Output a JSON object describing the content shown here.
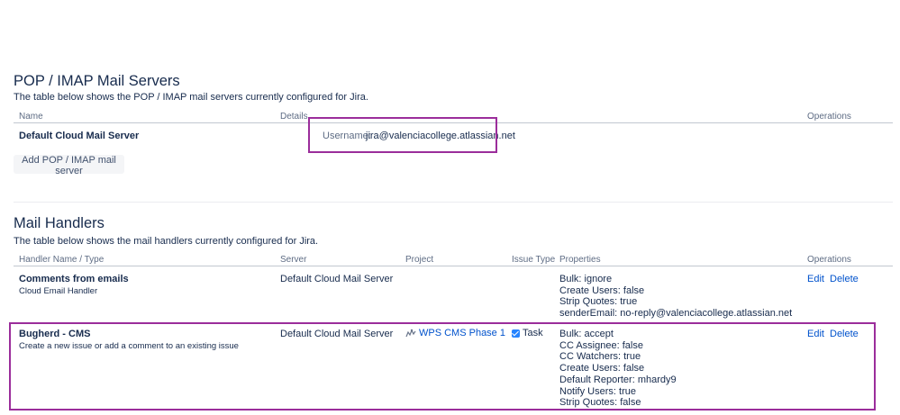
{
  "mail_servers": {
    "title": "POP / IMAP Mail Servers",
    "description": "The table below shows the POP / IMAP mail servers currently configured for Jira.",
    "columns": {
      "name": "Name",
      "details": "Details",
      "operations": "Operations"
    },
    "rows": [
      {
        "name": "Default Cloud Mail Server",
        "username_label": "Username:",
        "username": "jira@valenciacollege.atlassian.net"
      }
    ],
    "add_button": "Add POP / IMAP mail server"
  },
  "mail_handlers": {
    "title": "Mail Handlers",
    "description": "The table below shows the mail handlers currently configured for Jira.",
    "columns": {
      "name": "Handler Name / Type",
      "server": "Server",
      "project": "Project",
      "issue_type": "Issue Type",
      "properties": "Properties",
      "operations": "Operations"
    },
    "rows": [
      {
        "name": "Comments from emails",
        "type": "Cloud Email Handler",
        "server": "Default Cloud Mail Server",
        "project": "",
        "issue_type": "",
        "properties": [
          "Bulk: ignore",
          "Create Users: false",
          "Strip Quotes: true",
          "senderEmail: no-reply@valenciacollege.atlassian.net"
        ],
        "edit": "Edit",
        "delete": "Delete"
      },
      {
        "name": "Bugherd - CMS",
        "type": "Create a new issue or add a comment to an existing issue",
        "server": "Default Cloud Mail Server",
        "project": "WPS CMS Phase 1",
        "issue_type": "Task",
        "properties": [
          "Bulk: accept",
          "CC Assignee: false",
          "CC Watchers: true",
          "Create Users: false",
          "Default Reporter: mhardy9",
          "Notify Users: true",
          "Strip Quotes: false"
        ],
        "edit": "Edit",
        "delete": "Delete"
      }
    ]
  },
  "colors": {
    "highlight": "#9b2d9b",
    "link": "#0052cc",
    "text": "#172b4d"
  }
}
